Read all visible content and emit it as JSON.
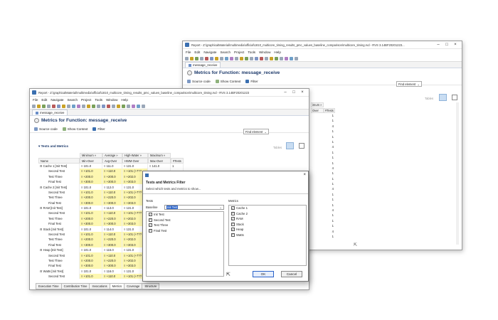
{
  "back_window": {
    "title": "Report - Z:\\graphicalMaterial\\multimedia\\official\\1810_multicore_timing_results_pmc_values_baseline_comparison\\multicore_timing.rvd - RVS 3.14BF20201223...",
    "menu": [
      "File",
      "Edit",
      "Navigate",
      "Search",
      "Project",
      "Tools",
      "Window",
      "Help"
    ],
    "tab": "message_receive",
    "heading": "Metrics for Function: message_receive",
    "actions": [
      "Source code",
      "Show Context",
      "Filter"
    ],
    "find": "Find element",
    "tables_label": "Tables",
    "col_headers": [
      "imum »",
      "Over",
      "#Tests"
    ],
    "tests_column": [
      "1",
      "1",
      "4",
      "1",
      "1",
      "1",
      "4",
      "1",
      "1",
      "1",
      "4",
      "1",
      "1",
      "1",
      "4",
      "1",
      "1",
      "1",
      "4",
      "1",
      "1",
      "1",
      "4",
      "1"
    ]
  },
  "front_window": {
    "title": "Report - Z:\\graphicalMaterial\\multimedia\\official\\1810_multicore_timing_results_pmc_values_baseline_comparison\\multicore_timing.rvd - RVS 3.14BF20201223",
    "menu": [
      "File",
      "Edit",
      "Navigate",
      "Search",
      "Project",
      "Tools",
      "Window",
      "Help"
    ],
    "tab": "message_receive",
    "heading": "Metrics for Function: message_receive",
    "actions": [
      "Source code",
      "Show Context",
      "Filter"
    ],
    "find": "Find element",
    "section": "Tests and Metrics",
    "tables_label": "Tables",
    "group_headers": [
      "Minimum »",
      "Average »",
      "High-Water »",
      "Maximum »"
    ],
    "col_headers": [
      "Name",
      "Min-Over",
      "Avg-Over",
      "HWM-Over",
      "Max-Over",
      "#Tests"
    ],
    "rows": [
      {
        "name": "⊟ Cache 1 [Init Test]",
        "min": "≡ 101.0",
        "avg": "≡ 111.0",
        "hwm": "≡ 131.0",
        "max": "≡ 141.0",
        "tests": "1"
      },
      {
        "name": "Second Test",
        "min": "≡ +101.0",
        "avg": "≡ +110.0",
        "hwm": "≡ +101 (+7??",
        "max": "",
        "tests": ""
      },
      {
        "name": "Test Three",
        "min": "≡ +200.0",
        "avg": "≡ +200.0",
        "hwm": "≡ +202.0",
        "max": "",
        "tests": ""
      },
      {
        "name": "Final Test",
        "min": "≡ +300.0",
        "avg": "≡ +300.0",
        "hwm": "≡ +303.0",
        "max": "",
        "tests": ""
      },
      {
        "name": "⊟ Cache 2 [Init Test]",
        "min": "≡ 101.0",
        "avg": "≡ 112.0",
        "hwm": "≡ 131.0",
        "max": "",
        "tests": ""
      },
      {
        "name": "Second Test",
        "min": "≡ +101.0",
        "avg": "≡ +110.0",
        "hwm": "≡ +101 (+7??",
        "max": "",
        "tests": ""
      },
      {
        "name": "Test Three",
        "min": "≡ +200.0",
        "avg": "≡ +220.0",
        "hwm": "≡ +202.0",
        "max": "",
        "tests": ""
      },
      {
        "name": "Final Test",
        "min": "≡ +300.0",
        "avg": "≡ +300.0",
        "hwm": "≡ +303.0",
        "max": "",
        "tests": ""
      },
      {
        "name": "⊟ RAM [Init Test]",
        "min": "≡ 101.0",
        "avg": "≡ 113.0",
        "hwm": "≡ 131.0",
        "max": "",
        "tests": ""
      },
      {
        "name": "Second Test",
        "min": "≡ +101.0",
        "avg": "≡ +110.0",
        "hwm": "≡ +101 (+7??",
        "max": "",
        "tests": ""
      },
      {
        "name": "Test Three",
        "min": "≡ +200.0",
        "avg": "≡ +220.0",
        "hwm": "≡ +202.0",
        "max": "",
        "tests": ""
      },
      {
        "name": "Final Test",
        "min": "≡ +300.0",
        "avg": "≡ +300.0",
        "hwm": "≡ +303.0",
        "max": "",
        "tests": ""
      },
      {
        "name": "⊟ Stack [Init Test]",
        "min": "≡ 101.0",
        "avg": "≡ 114.0",
        "hwm": "≡ 131.0",
        "max": "",
        "tests": ""
      },
      {
        "name": "Second Test",
        "min": "≡ +101.0",
        "avg": "≡ +110.0",
        "hwm": "≡ +101 (+7??",
        "max": "",
        "tests": ""
      },
      {
        "name": "Test Three",
        "min": "≡ +200.0",
        "avg": "≡ +220.0",
        "hwm": "≡ +202.0",
        "max": "",
        "tests": ""
      },
      {
        "name": "Final Test",
        "min": "≡ +300.0",
        "avg": "≡ +300.0",
        "hwm": "≡ +303.0",
        "max": "",
        "tests": ""
      },
      {
        "name": "⊟ Heap [Init Test]",
        "min": "≡ 101.0",
        "avg": "≡ 115.0",
        "hwm": "≡ 131.0",
        "max": "",
        "tests": ""
      },
      {
        "name": "Second Test",
        "min": "≡ +101.0",
        "avg": "≡ +110.0",
        "hwm": "≡ +101 (+7??",
        "max": "",
        "tests": ""
      },
      {
        "name": "Test Three",
        "min": "≡ +200.0",
        "avg": "≡ +220.0",
        "hwm": "≡ +202.0",
        "max": "",
        "tests": ""
      },
      {
        "name": "Final Test",
        "min": "≡ +300.0",
        "avg": "≡ +300.0",
        "hwm": "≡ +303.0",
        "max": "",
        "tests": ""
      },
      {
        "name": "⊟ Watts [Init Test]",
        "min": "≡ 101.0",
        "avg": "≡ 116.0",
        "hwm": "≡ 131.0",
        "max": "",
        "tests": ""
      },
      {
        "name": "Second Test",
        "min": "≡ +101.0",
        "avg": "≡ +110.0",
        "hwm": "≡ +101 (+7??",
        "max": "",
        "tests": ""
      }
    ],
    "bottom_tabs": [
      "Execution Time",
      "Contribution Time",
      "Invocations",
      "Metrics",
      "Coverage",
      "Structure"
    ]
  },
  "dialog": {
    "title": "Tests and Metrics Filter",
    "subtitle": "Select which tests and metrics to show...",
    "tests_label": "Tests",
    "metrics_label": "Metrics",
    "baseline_label": "Baseline",
    "baseline_value": "Init Test",
    "tests": [
      {
        "label": "Init Test",
        "checked": true
      },
      {
        "label": "Second Test",
        "checked": true
      },
      {
        "label": "Test Three",
        "checked": true
      },
      {
        "label": "Final Test",
        "checked": true
      }
    ],
    "metrics": [
      {
        "label": "Cache 1",
        "checked": true
      },
      {
        "label": "Cache 2",
        "checked": true
      },
      {
        "label": "RAM",
        "checked": true
      },
      {
        "label": "Stack",
        "checked": true
      },
      {
        "label": "Heap",
        "checked": true
      },
      {
        "label": "Watts",
        "checked": true
      }
    ],
    "ok_label": "OK",
    "cancel_label": "Cancel"
  },
  "colors": {
    "accent": "#2a62c9",
    "highlight": "#fdf7b0",
    "heading": "#1d3a6b"
  }
}
